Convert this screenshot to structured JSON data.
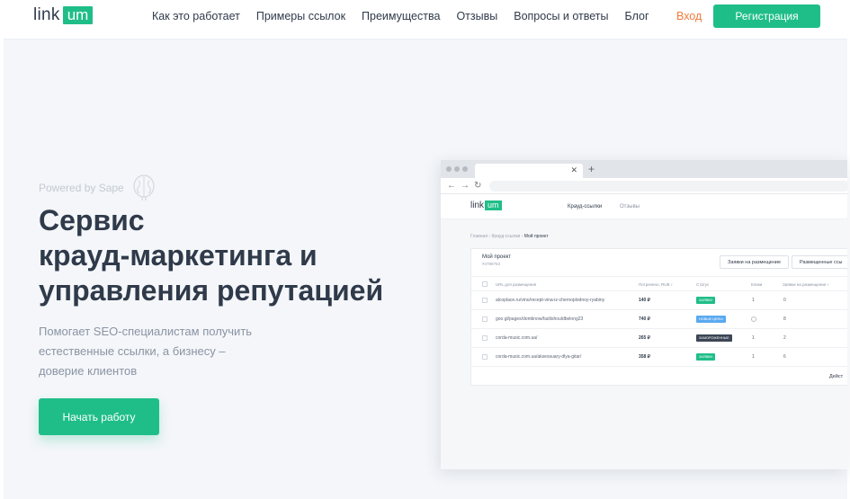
{
  "nav": {
    "logo_text": "link",
    "logo_badge": "um",
    "links": [
      "Как это работает",
      "Примеры ссылок",
      "Преимущества",
      "Отзывы",
      "Вопросы и ответы",
      "Блог"
    ],
    "login": "Вход",
    "register": "Регистрация"
  },
  "hero": {
    "powered_by": "Powered by Sape",
    "headline": [
      "Сервис",
      "крауд-маркетинга и",
      "управления репутацией"
    ],
    "subtitle": [
      "Помогает SEO-специалистам получить",
      "естественные ссылки, а бизнесу –",
      "доверие клиентов"
    ],
    "cta": "Начать работу"
  },
  "mockup": {
    "logo_text": "link",
    "logo_badge": "um",
    "nav": [
      "Крауд-ссылки",
      "Отзывы"
    ],
    "breadcrumbs": [
      "Главная",
      "Крауд-ссылки",
      "Мой проект"
    ],
    "project_title": "Мой проект",
    "project_id": "#4788763",
    "buttons": [
      "Заявки на размещение",
      "Размещенные ссы"
    ],
    "columns": [
      "URL для размещения",
      "Потрачено, RUB ↕",
      "Статус",
      "Клики",
      "Заявки на размещение ↕"
    ],
    "rows": [
      {
        "url": "alcoplace.ru/vino/recept-vina-iz-chernoplodnoy-ryabiny",
        "price": "140 ₽",
        "status": "ЗАЯВКИ",
        "status_color": "#1fbe88",
        "clicks": "1",
        "requests": "0"
      },
      {
        "url": "goo.gl/pages/dontknow/builtshouldbelong23",
        "price": "740 ₽",
        "status": "НОВЫЕ ЦЕНЫ",
        "status_color": "#5aa9f0",
        "clicks": "",
        "requests": "8"
      },
      {
        "url": "corda-music.com.ua/",
        "price": "265 ₽",
        "status": "ЗАМОРОЖЕННЫЕ",
        "status_color": "#3c4656",
        "clicks": "1",
        "requests": "2"
      },
      {
        "url": "corda-music.com.ua/aksessuary-dlya-gitar/",
        "price": "358 ₽",
        "status": "ЗАЯВКИ",
        "status_color": "#1fbe88",
        "clicks": "1",
        "requests": "6"
      }
    ],
    "actions_label": "Дейст"
  }
}
